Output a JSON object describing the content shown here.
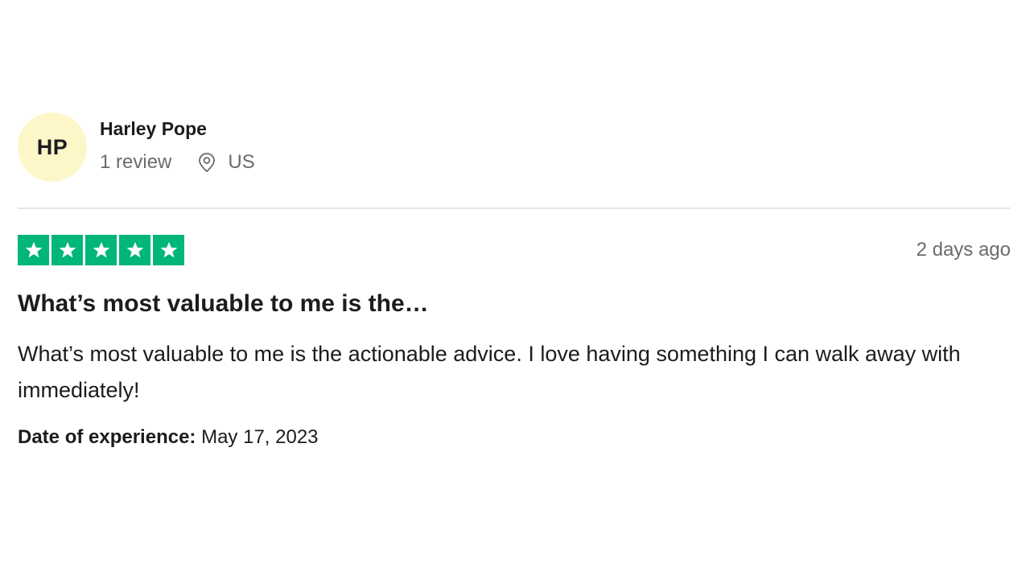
{
  "reviewer": {
    "initials": "HP",
    "name": "Harley Pope",
    "review_count": "1 review",
    "location": "US",
    "location_icon": "map-pin-icon",
    "avatar_color": "#fdf6c9"
  },
  "rating": {
    "stars": 5,
    "max_stars": 5,
    "star_color": "#00b67a",
    "star_icon": "star-icon",
    "posted": "2 days ago"
  },
  "review": {
    "title": "What’s most valuable to me is the…",
    "body": "What’s most valuable to me is the actionable advice. I love having something I can walk away with immediately!",
    "experience_label": "Date of experience:",
    "experience_date": "May 17, 2023"
  }
}
